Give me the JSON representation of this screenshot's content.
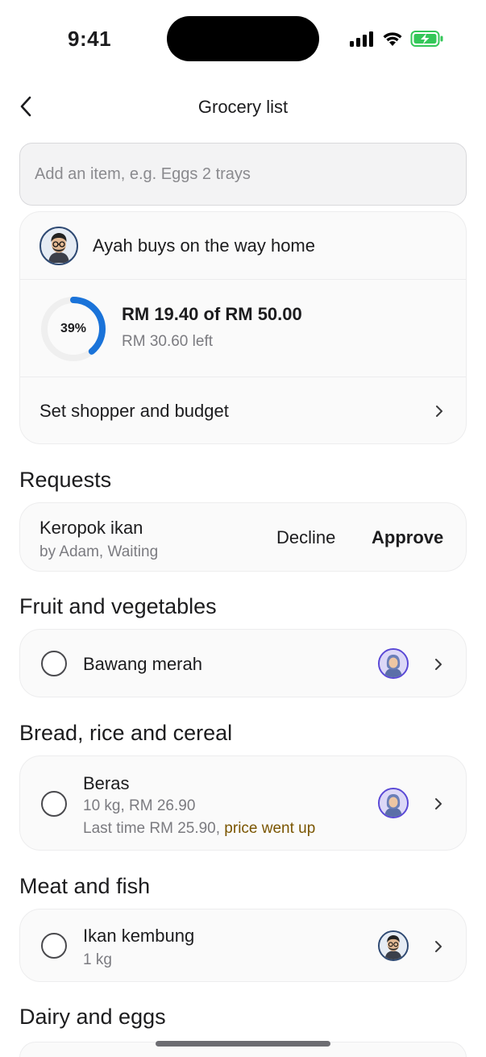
{
  "status_bar": {
    "time": "9:41",
    "icons": [
      "signal-icon",
      "wifi-icon",
      "battery-charging-icon"
    ]
  },
  "nav": {
    "title": "Grocery list",
    "back_icon": "chevron-left-icon"
  },
  "add_item": {
    "placeholder": "Add an item, e.g. Eggs 2 trays",
    "value": ""
  },
  "shopper": {
    "label": "Ayah buys on the way home",
    "avatar": "man-with-glasses-avatar",
    "budget_percent_text": "39%",
    "budget_progress": 0.39,
    "budget_main": "RM 19.40 of RM 50.00",
    "budget_sub": "RM 30.60 left",
    "set_label": "Set shopper and budget"
  },
  "sections": {
    "requests": "Requests",
    "fruit_veg": "Fruit and vegetables",
    "bread": "Bread, rice and cereal",
    "meat": "Meat and fish",
    "dairy": "Dairy and eggs"
  },
  "request": {
    "title": "Keropok ikan",
    "sub": "by Adam, Waiting",
    "decline": "Decline",
    "approve": "Approve"
  },
  "items": {
    "bawang": {
      "name": "Bawang merah",
      "avatar": "woman-hijab-avatar"
    },
    "beras": {
      "name": "Beras",
      "detail": "10 kg, RM 26.90",
      "last_price": "Last time RM 25.90, ",
      "warning": "price went up",
      "avatar": "woman-hijab-avatar"
    },
    "ikan": {
      "name": "Ikan kembung",
      "detail": "1 kg",
      "avatar": "man-with-glasses-avatar"
    }
  },
  "colors": {
    "accent_blue": "#1a73d9",
    "warning": "#7a5500",
    "assignee_purple": "#5a49d6"
  }
}
